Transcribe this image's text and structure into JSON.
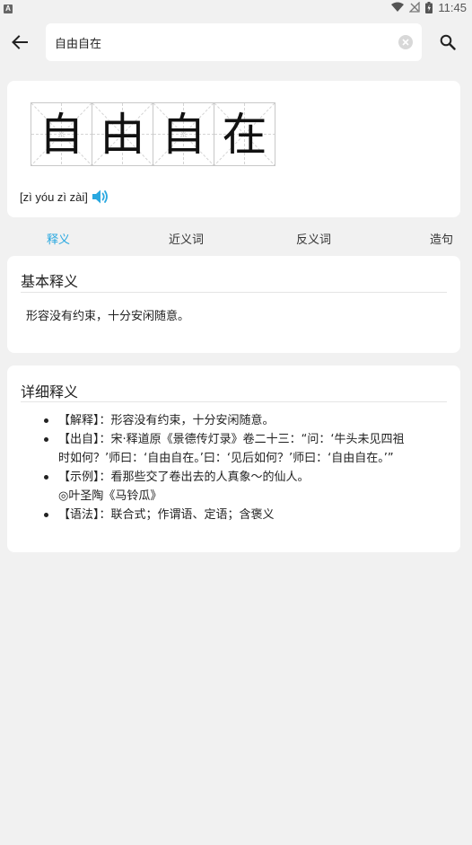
{
  "status_bar": {
    "left_icon": "A",
    "time": "11:45",
    "icons": [
      "wifi-icon",
      "no-signal-icon",
      "battery-icon"
    ]
  },
  "search": {
    "value": "自由自在",
    "placeholder": ""
  },
  "hero": {
    "characters": [
      "自",
      "由",
      "自",
      "在"
    ],
    "pinyin": "[zì yóu zì zài]"
  },
  "tabs": [
    {
      "label": "释义",
      "active": true
    },
    {
      "label": "近义词",
      "active": false
    },
    {
      "label": "反义词",
      "active": false
    },
    {
      "label": "造句",
      "active": false
    }
  ],
  "basic": {
    "title": "基本释义",
    "text": "形容没有约束，十分安闲随意。"
  },
  "detail": {
    "title": "详细释义",
    "items": [
      {
        "lines": [
          "【解释】：形容没有约束，十分安闲随意。"
        ]
      },
      {
        "lines": [
          "【出自】：宋·释道原《景德传灯录》卷二十三：“问：‘牛头未见四祖",
          "时如何？’师曰：‘自由自在。’曰：‘见后如何？’师曰：‘自由自在。’”"
        ]
      },
      {
        "lines": [
          "【示例】：看那些交了卷出去的人真象～的仙人。",
          "◎叶圣陶《马铃瓜》"
        ]
      },
      {
        "lines": [
          "【语法】：联合式；作谓语、定语；含褒义"
        ]
      }
    ]
  },
  "colors": {
    "accent": "#29a8e0",
    "background": "#f1f1f1",
    "card": "#ffffff"
  }
}
